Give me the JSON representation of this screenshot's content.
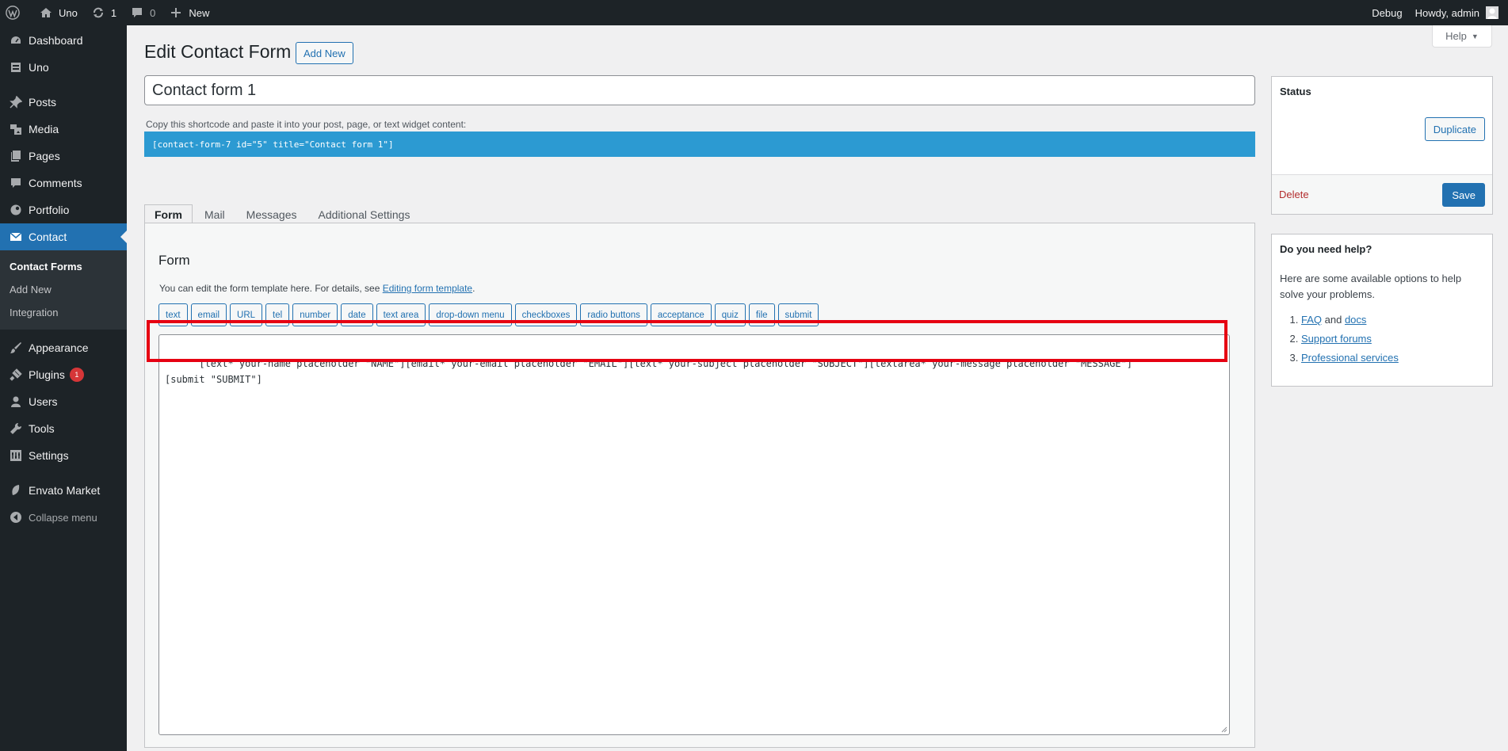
{
  "adminbar": {
    "site_name": "Uno",
    "updates_count": "1",
    "comments_count": "0",
    "new_label": "New",
    "debug_label": "Debug",
    "howdy_label": "Howdy, admin"
  },
  "sidebar": {
    "items": [
      {
        "label": "Dashboard",
        "icon": "dashboard-icon"
      },
      {
        "label": "Uno",
        "icon": "uno-icon"
      },
      {
        "label": "Posts",
        "icon": "pushpin-icon"
      },
      {
        "label": "Media",
        "icon": "media-icon"
      },
      {
        "label": "Pages",
        "icon": "pages-icon"
      },
      {
        "label": "Comments",
        "icon": "comment-icon"
      },
      {
        "label": "Portfolio",
        "icon": "portfolio-icon"
      },
      {
        "label": "Contact",
        "icon": "envelope-icon"
      },
      {
        "label": "Appearance",
        "icon": "brush-icon"
      },
      {
        "label": "Plugins",
        "icon": "plugin-icon",
        "badge": "1"
      },
      {
        "label": "Users",
        "icon": "user-icon"
      },
      {
        "label": "Tools",
        "icon": "wrench-icon"
      },
      {
        "label": "Settings",
        "icon": "settings-icon"
      },
      {
        "label": "Envato Market",
        "icon": "leaf-icon"
      },
      {
        "label": "Collapse menu",
        "icon": "collapse-icon"
      }
    ],
    "submenu": [
      "Contact Forms",
      "Add New",
      "Integration"
    ]
  },
  "header": {
    "help_label": "Help",
    "title": "Edit Contact Form",
    "add_new_label": "Add New"
  },
  "form": {
    "title_value": "Contact form 1",
    "shortcode_label": "Copy this shortcode and paste it into your post, page, or text widget content:",
    "shortcode": "[contact-form-7 id=\"5\" title=\"Contact form 1\"]",
    "tabs": [
      "Form",
      "Mail",
      "Messages",
      "Additional Settings"
    ],
    "panel_title": "Form",
    "desc_text": "You can edit the form template here. For details, see ",
    "desc_link": "Editing form template",
    "desc_end": ".",
    "tag_buttons": [
      "text",
      "email",
      "URL",
      "tel",
      "number",
      "date",
      "text area",
      "drop-down menu",
      "checkboxes",
      "radio buttons",
      "acceptance",
      "quiz",
      "file",
      "submit"
    ],
    "template": "[text* your-name placeholder \"NAME\"][email* your-email placeholder \"EMAIL\"][text* your-subject placeholder \"SUBJECT\"][textarea* your-message placeholder \"MESSAGE\"]\n[submit \"SUBMIT\"]"
  },
  "status_box": {
    "title": "Status",
    "duplicate_label": "Duplicate",
    "delete_label": "Delete",
    "save_label": "Save"
  },
  "help_box": {
    "title": "Do you need help?",
    "intro": "Here are some available options to help solve your problems.",
    "item1_a": "FAQ",
    "item1_and": " and ",
    "item1_b": "docs",
    "item2": "Support forums",
    "item3": "Professional services"
  },
  "colors": {
    "admin_bar_bg": "#1d2327",
    "accent": "#2271b1",
    "shortcode_bg": "#2c9ad2",
    "highlight": "#e60012",
    "delete": "#b32d2e"
  }
}
